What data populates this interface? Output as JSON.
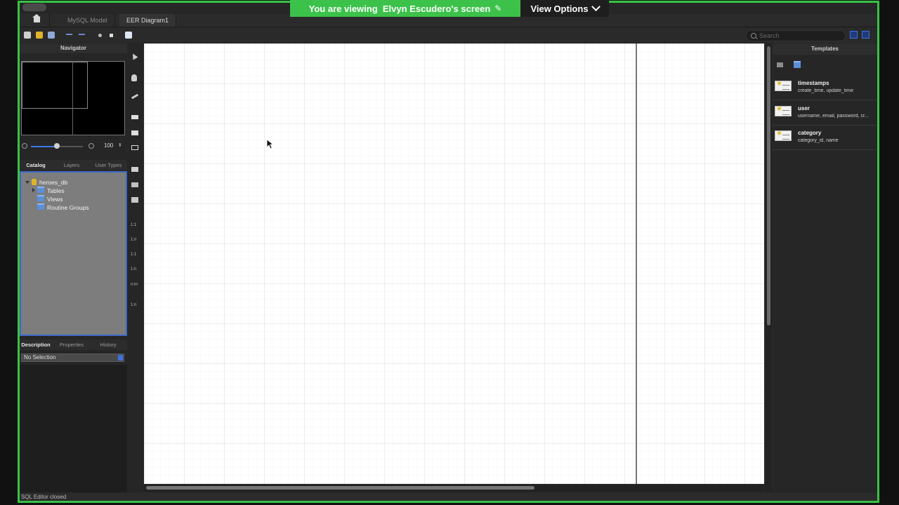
{
  "share": {
    "banner_text": "You are viewing  Elvyn Escudero's screen",
    "pen_glyph": "✎",
    "view_options_label": "View Options"
  },
  "tabs": {
    "model": "MySQL Model",
    "eer": "EER Diagram1"
  },
  "search": {
    "placeholder": "Search"
  },
  "navigator": {
    "title": "Navigator",
    "zoom_value": "100",
    "zoom_level": 0.5
  },
  "catalog": {
    "tabs": [
      "Catalog",
      "Layers",
      "User Types"
    ],
    "tree": {
      "db": "heroes_db",
      "children": [
        "Tables",
        "Views",
        "Routine Groups"
      ]
    }
  },
  "description": {
    "tabs": [
      "Description",
      "Properties",
      "History"
    ],
    "selection": "No Selection"
  },
  "tool_palette": {
    "labels": [
      "1:1",
      "1:n",
      "1:1",
      "1:n",
      "n:m",
      "1:n"
    ]
  },
  "templates": {
    "title": "Templates",
    "items": [
      {
        "name": "timestamps",
        "fields": "create_time, update_time"
      },
      {
        "name": "user",
        "fields": "username, email, password, cr..."
      },
      {
        "name": "category",
        "fields": "category_id, name"
      }
    ]
  },
  "status": {
    "text": "SQL Editor closed"
  },
  "colors": {
    "accent": "#3cc24a",
    "selection_blue": "#3b69c6"
  }
}
